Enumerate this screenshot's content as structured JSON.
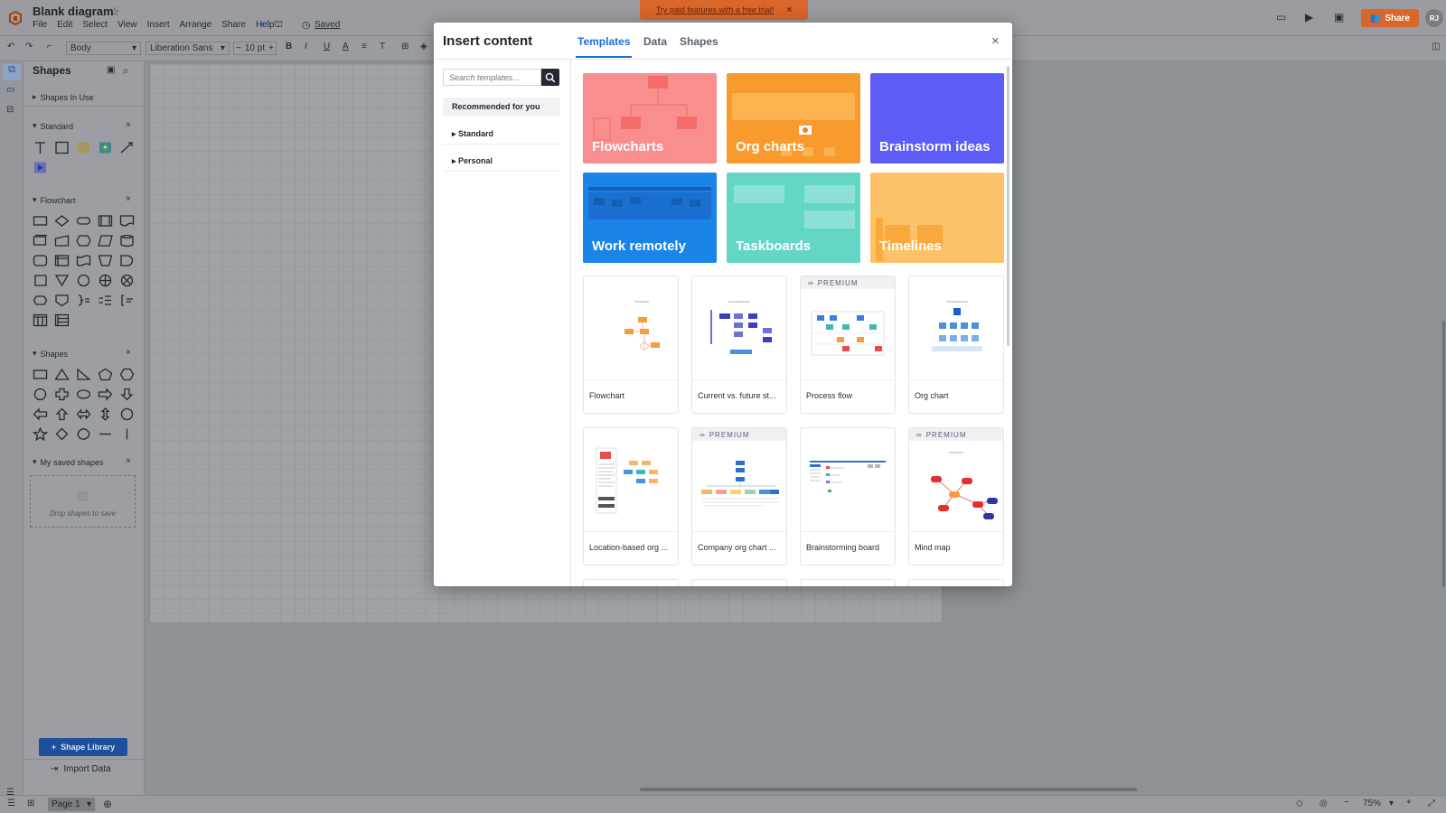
{
  "app": {
    "doc_title": "Blank diagram",
    "menus": [
      "File",
      "Edit",
      "Select",
      "View",
      "Insert",
      "Arrange",
      "Share",
      "Help"
    ],
    "saved_label": "Saved",
    "share_label": "Share",
    "avatar_initials": "RJ",
    "trial_banner": "Try paid features with a free trial!",
    "accent_color": "#d9662a"
  },
  "toolbar": {
    "style_select": "Body",
    "font_select": "Liberation Sans",
    "font_size": "10 pt",
    "bold": "B",
    "italic": "I",
    "underline": "U",
    "font_color": "A"
  },
  "sidebar": {
    "title": "Shapes",
    "shapes_in_use": "Shapes In Use",
    "sections": [
      {
        "title": "Standard"
      },
      {
        "title": "Flowchart"
      },
      {
        "title": "Shapes"
      },
      {
        "title": "My saved shapes"
      }
    ],
    "drop_text": "Drop shapes to save",
    "shape_library_label": "Shape Library",
    "import_data_label": "Import Data"
  },
  "bottom": {
    "page_label": "Page 1",
    "zoom": "75%"
  },
  "modal": {
    "title": "Insert content",
    "tabs": [
      "Templates",
      "Data",
      "Shapes"
    ],
    "active_tab": "Templates",
    "search_placeholder": "Search templates...",
    "categories": [
      "Recommended for you",
      "Standard",
      "Personal"
    ],
    "tiles": [
      {
        "label": "Flowcharts",
        "color": "#f98e8f"
      },
      {
        "label": "Org charts",
        "color": "#f99a2e"
      },
      {
        "label": "Brainstorm ideas",
        "color": "#5c5cf6"
      },
      {
        "label": "Work remotely",
        "color": "#1b84e8"
      },
      {
        "label": "Taskboards",
        "color": "#63d6c4"
      },
      {
        "label": "Timelines",
        "color": "#fdc168"
      }
    ],
    "premium_label": "PREMIUM",
    "cards": [
      {
        "label": "Flowchart",
        "premium": false
      },
      {
        "label": "Current vs. future st...",
        "premium": false
      },
      {
        "label": "Process flow",
        "premium": true
      },
      {
        "label": "Org chart",
        "premium": false
      },
      {
        "label": "Location-based org ...",
        "premium": false
      },
      {
        "label": "Company org chart ...",
        "premium": true
      },
      {
        "label": "Brainstorming board",
        "premium": false
      },
      {
        "label": "Mind map",
        "premium": true
      }
    ]
  }
}
